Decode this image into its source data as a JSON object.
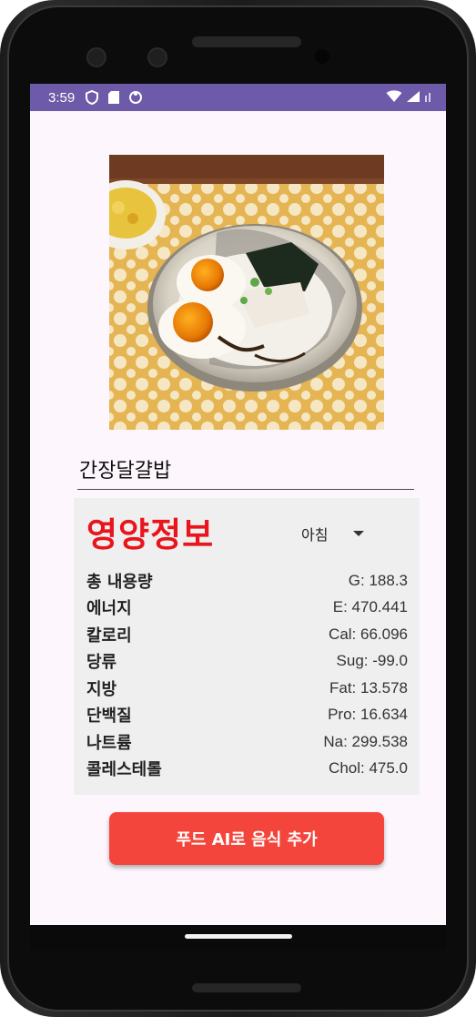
{
  "status_bar": {
    "time": "3:59",
    "icons": [
      "shield-icon",
      "sd-card-icon",
      "sync-icon"
    ],
    "right_icons": [
      "wifi-icon",
      "signal-icon"
    ]
  },
  "food": {
    "image_name": "food-photo",
    "name": "간장달걀밥"
  },
  "nutrition": {
    "title": "영양정보",
    "meal_selected": "아침",
    "rows": [
      {
        "label": "총 내용량",
        "value": "G: 188.3"
      },
      {
        "label": "에너지",
        "value": "E: 470.441"
      },
      {
        "label": "칼로리",
        "value": "Cal: 66.096"
      },
      {
        "label": "당류",
        "value": "Sug: -99.0"
      },
      {
        "label": "지방",
        "value": "Fat: 13.578"
      },
      {
        "label": "단백질",
        "value": "Pro: 16.634"
      },
      {
        "label": "나트륨",
        "value": "Na: 299.538"
      },
      {
        "label": "콜레스테롤",
        "value": "Chol: 475.0"
      }
    ]
  },
  "actions": {
    "add_button_label": "푸드 AI로 음식 추가"
  },
  "colors": {
    "status_bar": "#6d5aa8",
    "title_red": "#e8151c",
    "button": "#f3453b",
    "screen_bg": "#fdf7fd"
  }
}
